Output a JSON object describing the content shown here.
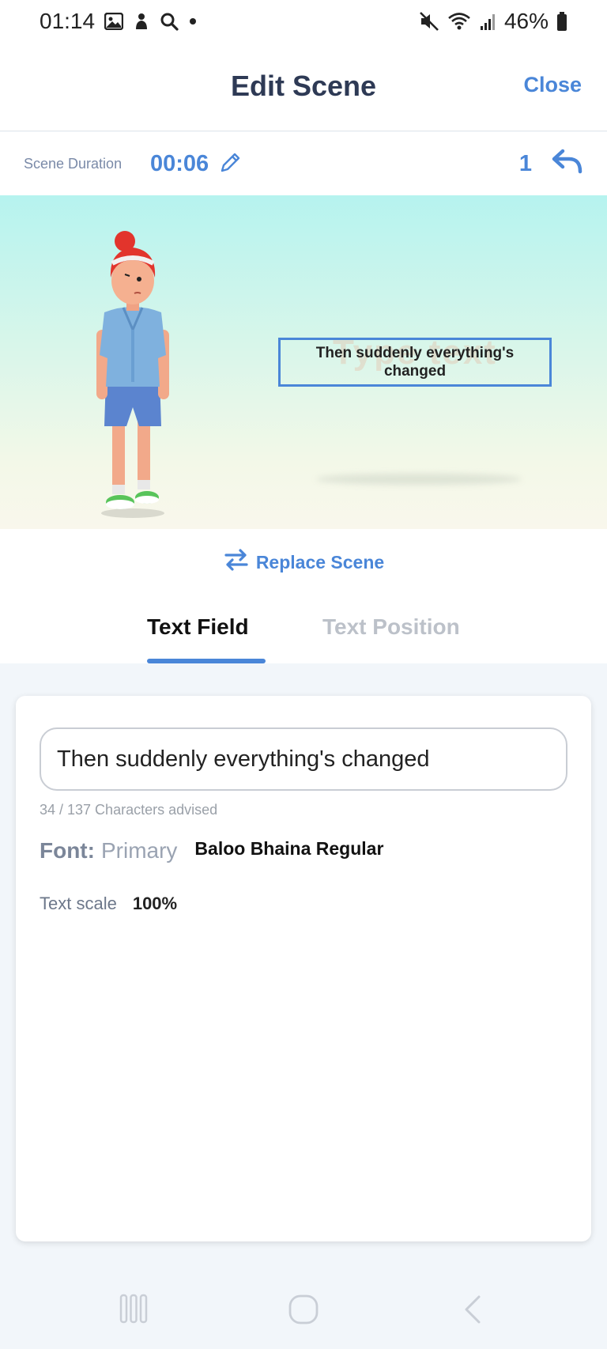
{
  "status_bar": {
    "time": "01:14",
    "battery": "46%",
    "icons": [
      "gallery-icon",
      "notification-icon",
      "search-icon",
      "dot-icon",
      "mute-icon",
      "wifi-icon",
      "signal-icon",
      "battery-icon"
    ]
  },
  "header": {
    "title": "Edit Scene",
    "close_label": "Close"
  },
  "duration": {
    "label": "Scene Duration",
    "value": "00:06",
    "undo_count": "1"
  },
  "preview": {
    "overlay_text": "Then suddenly everything's changed",
    "ghost_text": "Type text"
  },
  "replace_scene": {
    "label": "Replace Scene"
  },
  "tabs": {
    "text_field": "Text Field",
    "text_position": "Text Position",
    "active": "text_field"
  },
  "editor": {
    "text_value": "Then suddenly everything's changed",
    "char_count": "34 / 137 Characters advised",
    "font_label": "Font:",
    "font_type": "Primary",
    "font_name": "Baloo Bhaina Regular",
    "scale_label": "Text scale",
    "scale_value": "100%"
  },
  "colors": {
    "accent": "#4a86d8",
    "title": "#2e3a55",
    "background": "#f2f6fa"
  }
}
